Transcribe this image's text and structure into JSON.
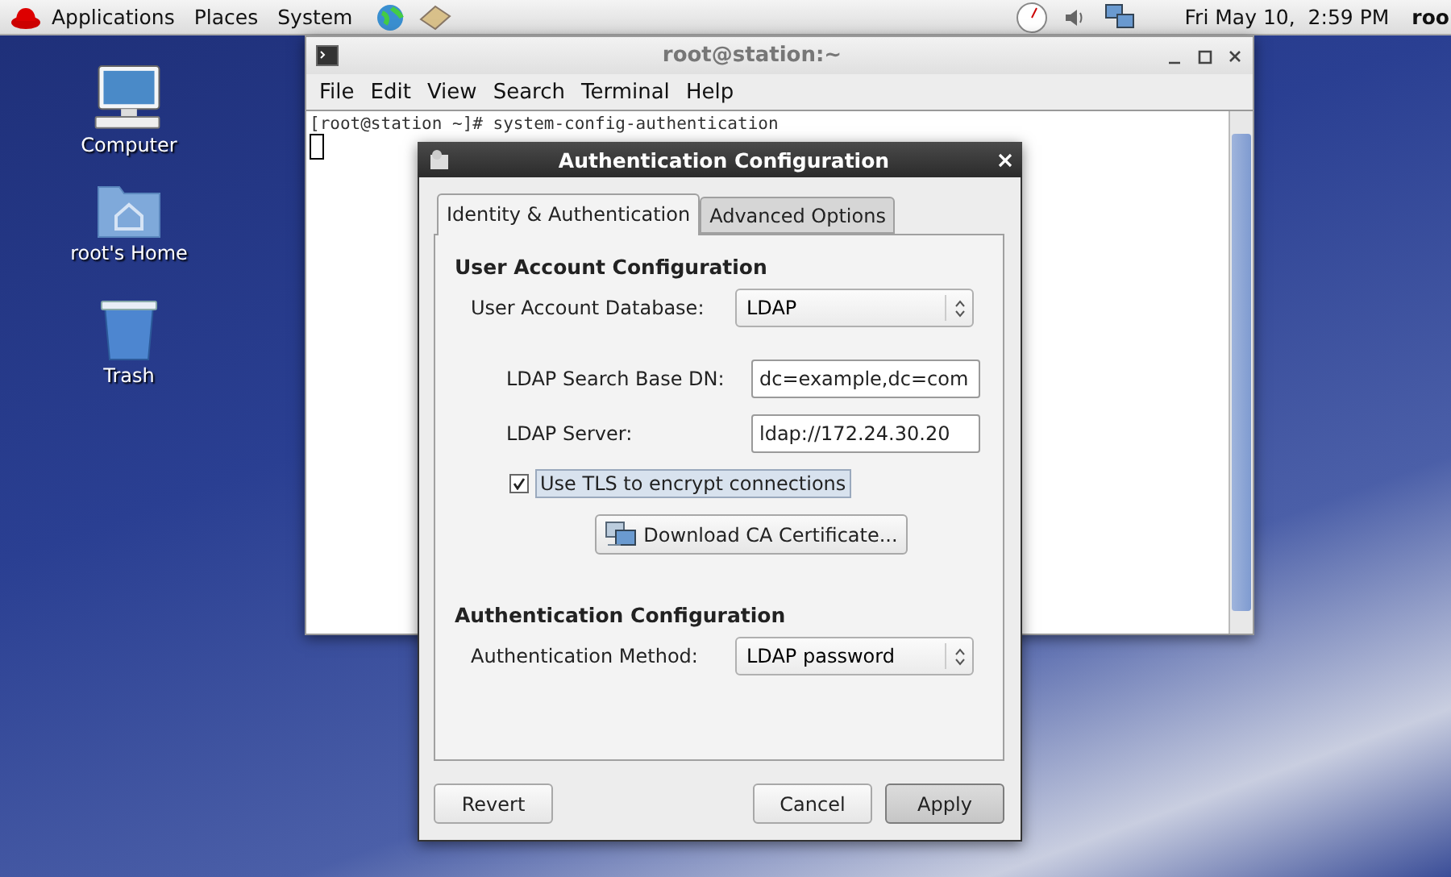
{
  "top_panel": {
    "menus": [
      "Applications",
      "Places",
      "System"
    ],
    "clock": "Fri May 10,  2:59 PM",
    "user": "roo"
  },
  "desktop_icons": [
    {
      "kind": "computer",
      "label": "Computer"
    },
    {
      "kind": "home",
      "label": "root's Home"
    },
    {
      "kind": "trash",
      "label": "Trash"
    }
  ],
  "terminal": {
    "title": "root@station:~",
    "menu": [
      "File",
      "Edit",
      "View",
      "Search",
      "Terminal",
      "Help"
    ],
    "lines": [
      "[root@station ~]# system-config-authentication"
    ]
  },
  "dialog": {
    "title": "Authentication Configuration",
    "tabs": [
      {
        "label": "Identity & Authentication",
        "selected": true
      },
      {
        "label": "Advanced Options",
        "selected": false
      }
    ],
    "sections": [
      {
        "heading": "User Account Configuration",
        "rows": [
          {
            "kind": "select",
            "label": "User Account Database:",
            "value": "LDAP"
          },
          {
            "kind": "text",
            "label": "LDAP Search Base DN:",
            "value": "dc=example,dc=com"
          },
          {
            "kind": "text",
            "label": "LDAP Server:",
            "value": "ldap://172.24.30.20"
          },
          {
            "kind": "checkbox",
            "label": "Use TLS to encrypt connections",
            "checked": true
          },
          {
            "kind": "button",
            "label": "Download CA Certificate..."
          }
        ]
      },
      {
        "heading": "Authentication Configuration",
        "rows": [
          {
            "kind": "select",
            "label": "Authentication Method:",
            "value": "LDAP password"
          }
        ]
      }
    ],
    "buttons": [
      {
        "label": "Revert",
        "default": false
      },
      {
        "label": "Cancel",
        "default": false
      },
      {
        "label": "Apply",
        "default": true
      }
    ]
  }
}
